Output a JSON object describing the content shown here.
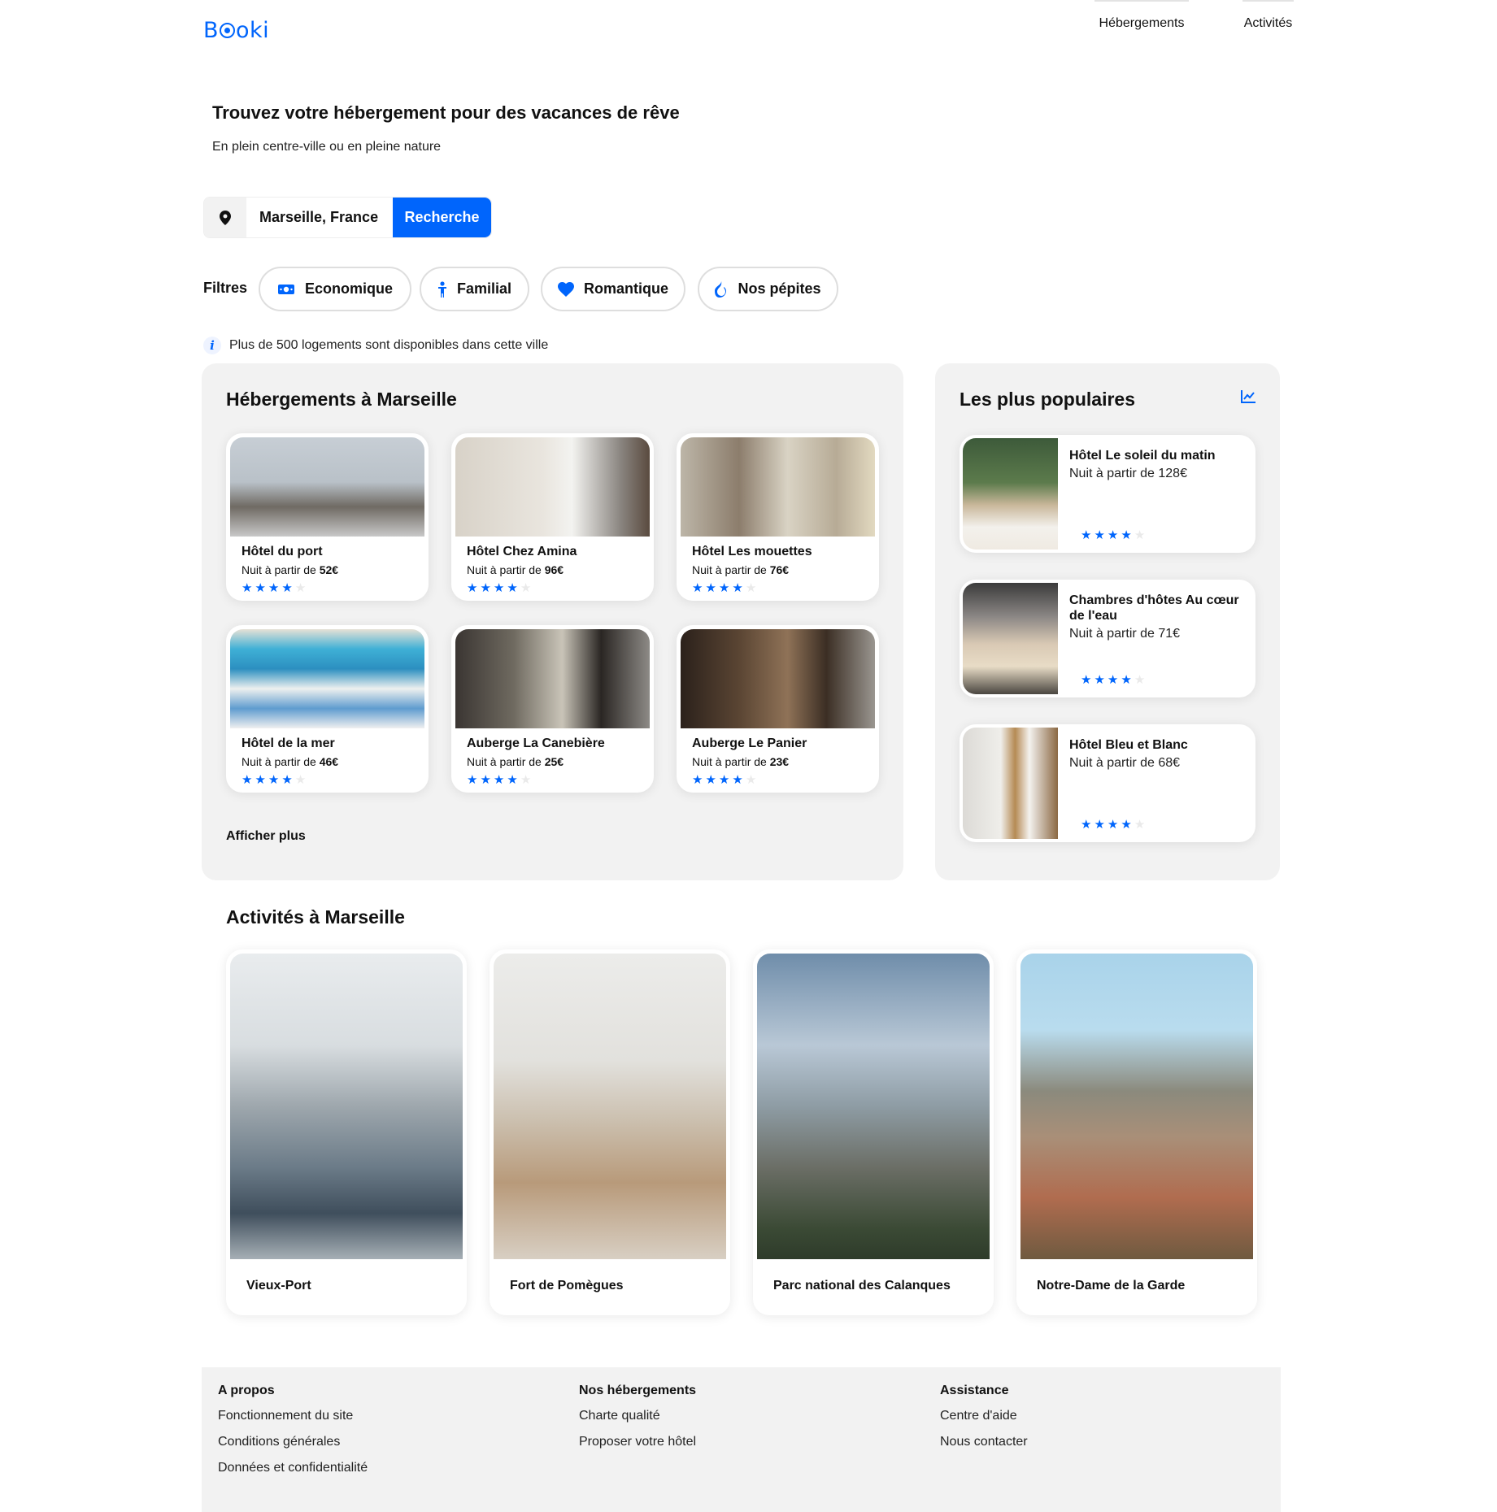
{
  "header": {
    "logo": "Booki",
    "nav": [
      "Hébergements",
      "Activités"
    ]
  },
  "hero": {
    "title": "Trouvez votre hébergement pour des vacances de rêve",
    "subtitle": "En plein centre-ville ou en pleine nature"
  },
  "search": {
    "value": "Marseille, France",
    "button": "Recherche",
    "icon": "location-pin-icon"
  },
  "filters": {
    "label": "Filtres",
    "items": [
      {
        "label": "Economique",
        "icon": "money-icon"
      },
      {
        "label": "Familial",
        "icon": "child-icon"
      },
      {
        "label": "Romantique",
        "icon": "heart-icon"
      },
      {
        "label": "Nos pépites",
        "icon": "fire-icon"
      }
    ]
  },
  "info": "Plus de 500 logements sont disponibles dans cette ville",
  "accommodations": {
    "title": "Hébergements à Marseille",
    "price_prefix": "Nuit à partir de",
    "items": [
      {
        "name": "Hôtel du port",
        "price": "52€",
        "rating": 4
      },
      {
        "name": "Hôtel Chez Amina",
        "price": "96€",
        "rating": 4
      },
      {
        "name": "Hôtel Les mouettes",
        "price": "76€",
        "rating": 4
      },
      {
        "name": "Hôtel de la mer",
        "price": "46€",
        "rating": 4
      },
      {
        "name": "Auberge La Canebière",
        "price": "25€",
        "rating": 4
      },
      {
        "name": "Auberge Le Panier",
        "price": "23€",
        "rating": 4
      }
    ],
    "show_more": "Afficher plus"
  },
  "popular": {
    "title": "Les plus populaires",
    "icon": "trend-chart-icon",
    "items": [
      {
        "name": "Hôtel Le soleil du matin",
        "price": "Nuit à partir de 128€",
        "rating": 4
      },
      {
        "name": "Chambres d'hôtes Au cœur de l'eau",
        "price": "Nuit à partir de 71€",
        "rating": 4
      },
      {
        "name": "Hôtel Bleu et Blanc",
        "price": "Nuit à partir de 68€",
        "rating": 4
      }
    ]
  },
  "activities": {
    "title": "Activités à Marseille",
    "items": [
      {
        "name": "Vieux-Port"
      },
      {
        "name": "Fort de Pomègues"
      },
      {
        "name": "Parc national des Calanques"
      },
      {
        "name": "Notre-Dame de la Garde"
      }
    ]
  },
  "footer": {
    "columns": [
      {
        "title": "A propos",
        "links": [
          "Fonctionnement du site",
          "Conditions générales",
          "Données et confidentialité"
        ]
      },
      {
        "title": "Nos hébergements",
        "links": [
          "Charte qualité",
          "Proposer votre hôtel"
        ]
      },
      {
        "title": "Assistance",
        "links": [
          "Centre d'aide",
          "Nous contacter"
        ]
      }
    ]
  },
  "colors": {
    "accent": "#0065fc",
    "panel": "#f2f2f2"
  }
}
